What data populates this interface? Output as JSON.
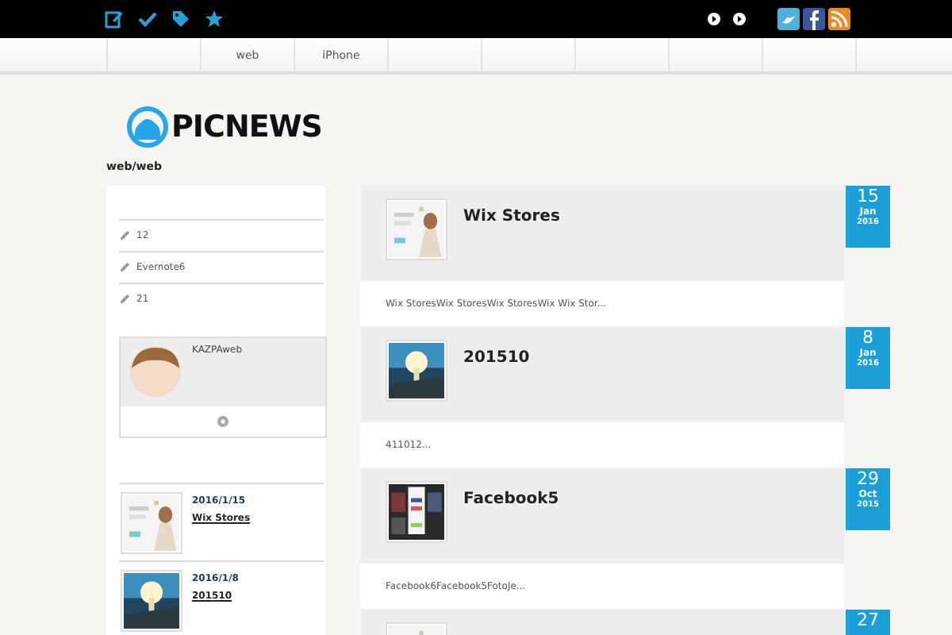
{
  "nav_items": [
    "web",
    "iPhone"
  ],
  "logo": {
    "text": "PICNEWS"
  },
  "breadcrumb": "web/web",
  "sidebar": {
    "links": [
      "12",
      "Evernote6",
      "21"
    ],
    "profile": {
      "name": "KAZPAweb"
    },
    "recent": [
      {
        "date": "2016/1/15",
        "title": "Wix Stores"
      },
      {
        "date": "2016/1/8",
        "title": "201510"
      }
    ]
  },
  "posts": [
    {
      "title": "Wix Stores",
      "excerpt": "Wix StoresWix StoresWix StoresWix Wix Stor...",
      "day": "15",
      "month": "Jan",
      "year": "2016"
    },
    {
      "title": "201510",
      "excerpt": "411012...",
      "day": "8",
      "month": "Jan",
      "year": "2016"
    },
    {
      "title": "Facebook5",
      "excerpt": "Facebook6Facebook5FotoJe...",
      "day": "29",
      "month": "Oct",
      "year": "2015"
    },
    {
      "day": "27"
    }
  ]
}
